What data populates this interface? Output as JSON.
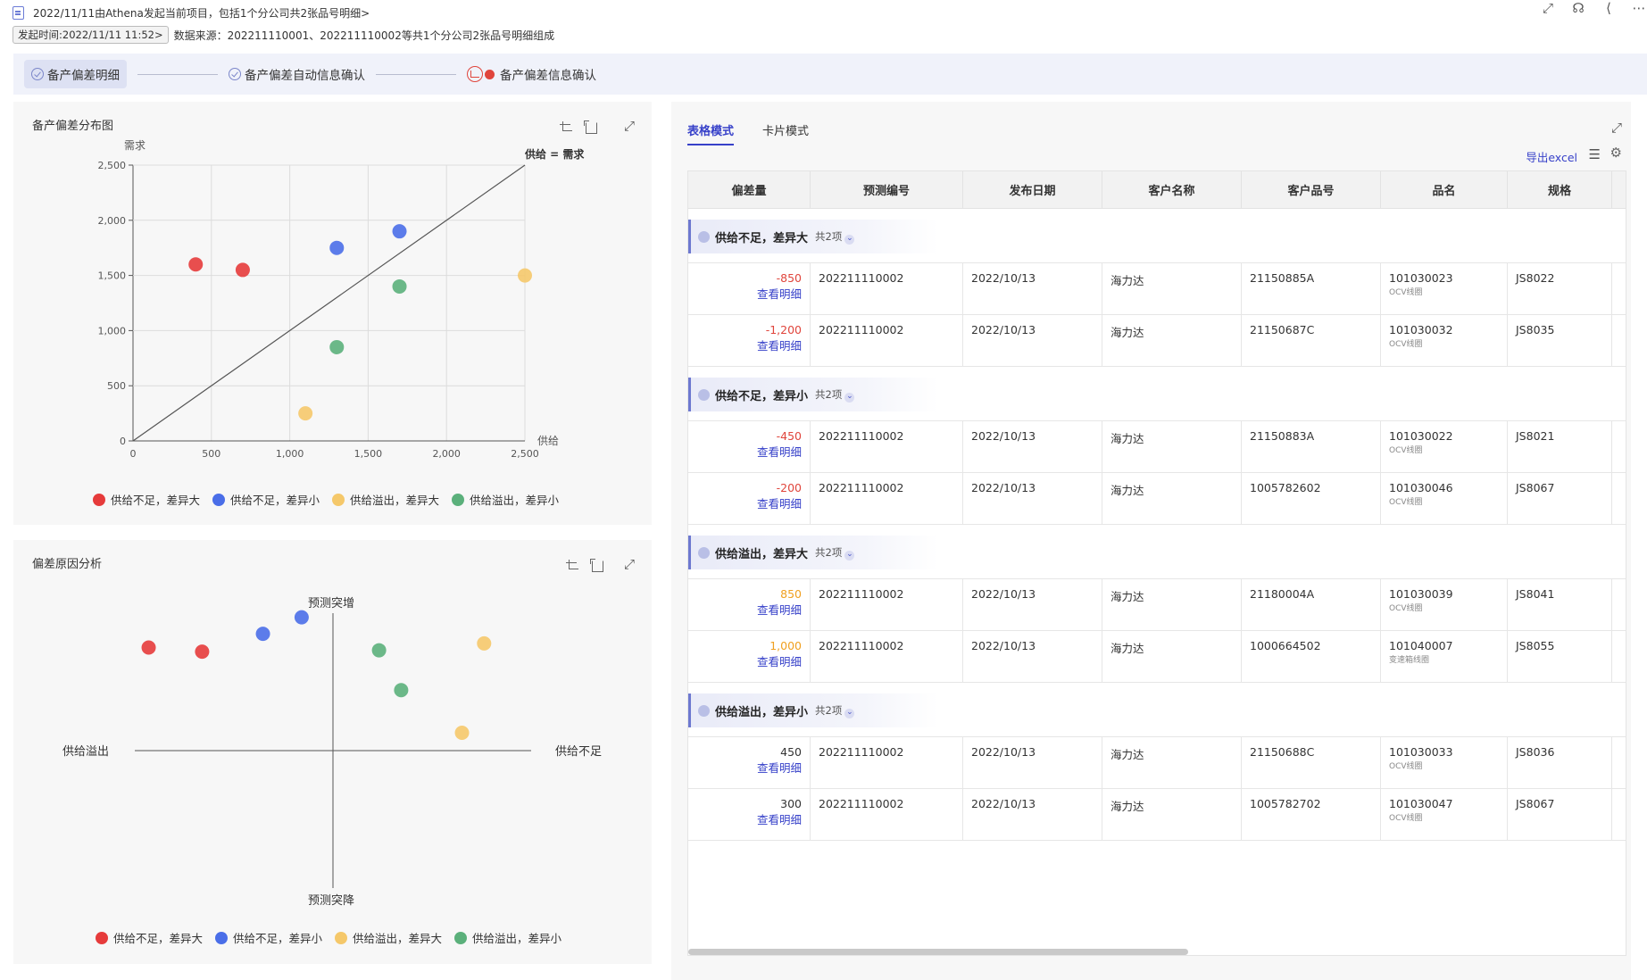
{
  "header": {
    "line1": "2022/11/11由Athena发起当前项目，包括1个分公司共2张品号明细>",
    "time_chip": "发起时间:2022/11/11 11:52>",
    "source": "数据来源：202211110001、202211110002等共1个分公司2张品号明细组成"
  },
  "steps": [
    {
      "label": "备产偏差明细"
    },
    {
      "label": "备产偏差自动信息确认"
    },
    {
      "label": "备产偏差信息确认"
    }
  ],
  "scatter_panel": {
    "title": "备产偏差分布图"
  },
  "quadrant_panel": {
    "title": "偏差原因分析",
    "top_label": "预测突增",
    "bottom_label": "预测突降",
    "left_label": "供给溢出",
    "right_label": "供给不足"
  },
  "legend": [
    {
      "label": "供给不足，差异大",
      "color": "#e63b3b"
    },
    {
      "label": "供给不足，差异小",
      "color": "#4a6ee8"
    },
    {
      "label": "供给溢出，差异大",
      "color": "#f5c86a"
    },
    {
      "label": "供给溢出，差异小",
      "color": "#5bb07b"
    }
  ],
  "chart_data": [
    {
      "type": "scatter",
      "title": "备产偏差分布图",
      "xlabel": "供给",
      "ylabel": "需求",
      "xlim": [
        0,
        2500
      ],
      "ylim": [
        0,
        2500
      ],
      "xticks": [
        0,
        500,
        1000,
        1500,
        2000,
        2500
      ],
      "yticks": [
        0,
        500,
        1000,
        1500,
        2000,
        2500
      ],
      "reference_line_label": "供给 = 需求",
      "grid": true,
      "legend_position": "bottom",
      "series": [
        {
          "name": "供给不足，差异大",
          "color": "#e63b3b",
          "points": [
            [
              400,
              1600
            ],
            [
              700,
              1550
            ]
          ]
        },
        {
          "name": "供给不足，差异小",
          "color": "#4a6ee8",
          "points": [
            [
              1300,
              1750
            ],
            [
              1700,
              1900
            ]
          ]
        },
        {
          "name": "供给溢出，差异大",
          "color": "#f5c86a",
          "points": [
            [
              1100,
              250
            ],
            [
              2500,
              1500
            ]
          ]
        },
        {
          "name": "供给溢出，差异小",
          "color": "#5bb07b",
          "points": [
            [
              1300,
              850
            ],
            [
              1700,
              1400
            ]
          ]
        }
      ]
    },
    {
      "type": "scatter",
      "title": "偏差原因分析",
      "legend_position": "bottom",
      "series": [
        {
          "name": "供给不足，差异大",
          "color": "#e63b3b",
          "points": [
            [
              -1.0,
              0.75
            ],
            [
              -0.71,
              0.72
            ]
          ]
        },
        {
          "name": "供给不足，差异小",
          "color": "#4a6ee8",
          "points": [
            [
              -0.38,
              0.85
            ],
            [
              -0.17,
              0.97
            ]
          ]
        },
        {
          "name": "供给溢出，差异大",
          "color": "#f5c86a",
          "points": [
            [
              0.82,
              0.78
            ],
            [
              0.7,
              0.13
            ]
          ]
        },
        {
          "name": "供给溢出，差异小",
          "color": "#5bb07b",
          "points": [
            [
              0.25,
              0.73
            ],
            [
              0.37,
              0.44
            ]
          ]
        }
      ]
    }
  ],
  "table": {
    "tabs": [
      "表格模式",
      "卡片模式"
    ],
    "export_label": "导出excel",
    "columns": [
      "偏差量",
      "预测编号",
      "发布日期",
      "客户名称",
      "客户品号",
      "品名",
      "规格"
    ],
    "link_label": "查看明细",
    "groups": [
      {
        "title": "供给不足，差异大",
        "count": "共2项",
        "rows": [
          {
            "deviation": "-850",
            "kind": "neg",
            "forecast_no": "202211110002",
            "date": "2022/10/13",
            "customer": "海力达",
            "cust_part": "21150885A",
            "part": "101030023",
            "part_sub": "OCV线圈",
            "spec": "JS8022"
          },
          {
            "deviation": "-1,200",
            "kind": "neg",
            "forecast_no": "202211110002",
            "date": "2022/10/13",
            "customer": "海力达",
            "cust_part": "21150687C",
            "part": "101030032",
            "part_sub": "OCV线圈",
            "spec": "JS8035"
          }
        ]
      },
      {
        "title": "供给不足，差异小",
        "count": "共2项",
        "rows": [
          {
            "deviation": "-450",
            "kind": "neg",
            "forecast_no": "202211110002",
            "date": "2022/10/13",
            "customer": "海力达",
            "cust_part": "21150883A",
            "part": "101030022",
            "part_sub": "OCV线圈",
            "spec": "JS8021"
          },
          {
            "deviation": "-200",
            "kind": "neg",
            "forecast_no": "202211110002",
            "date": "2022/10/13",
            "customer": "海力达",
            "cust_part": "1005782602",
            "part": "101030046",
            "part_sub": "OCV线圈",
            "spec": "JS8067"
          }
        ]
      },
      {
        "title": "供给溢出，差异大",
        "count": "共2项",
        "rows": [
          {
            "deviation": "850",
            "kind": "pos",
            "forecast_no": "202211110002",
            "date": "2022/10/13",
            "customer": "海力达",
            "cust_part": "21180004A",
            "part": "101030039",
            "part_sub": "OCV线圈",
            "spec": "JS8041"
          },
          {
            "deviation": "1,000",
            "kind": "pos",
            "forecast_no": "202211110002",
            "date": "2022/10/13",
            "customer": "海力达",
            "cust_part": "1000664502",
            "part": "101040007",
            "part_sub": "变速箱线圈",
            "spec": "JS8055"
          }
        ]
      },
      {
        "title": "供给溢出，差异小",
        "count": "共2项",
        "rows": [
          {
            "deviation": "450",
            "kind": "plain",
            "forecast_no": "202211110002",
            "date": "2022/10/13",
            "customer": "海力达",
            "cust_part": "21150688C",
            "part": "101030033",
            "part_sub": "OCV线圈",
            "spec": "JS8036"
          },
          {
            "deviation": "300",
            "kind": "plain",
            "forecast_no": "202211110002",
            "date": "2022/10/13",
            "customer": "海力达",
            "cust_part": "1005782702",
            "part": "101030047",
            "part_sub": "OCV线圈",
            "spec": "JS8067"
          }
        ]
      }
    ]
  }
}
